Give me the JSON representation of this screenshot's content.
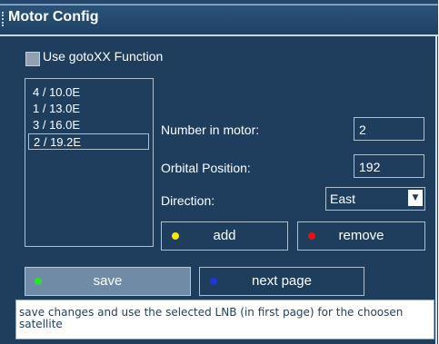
{
  "window": {
    "title": "Motor Config"
  },
  "options": {
    "use_gotoxx_label": "Use gotoXX Function",
    "use_gotoxx_checked": false
  },
  "satellite_list": {
    "items": [
      "4 / 10.0E",
      "1 / 13.0E",
      "3 / 16.0E",
      "2 / 19.2E"
    ],
    "selected_index": 3
  },
  "form": {
    "number_label": "Number in motor:",
    "number_value": "2",
    "orbital_label": "Orbital Position:",
    "orbital_value": "192",
    "direction_label": "Direction:",
    "direction_value": "East"
  },
  "buttons": {
    "add": "add",
    "remove": "remove",
    "save": "save",
    "next_page": "next page"
  },
  "colors": {
    "add_dot": "#f3e600",
    "remove_dot": "#e01515",
    "save_dot": "#2ee02e",
    "next_dot": "#1d36d8"
  },
  "status": {
    "text": "save changes and use the selected LNB (in first page) for the choosen satellite"
  }
}
